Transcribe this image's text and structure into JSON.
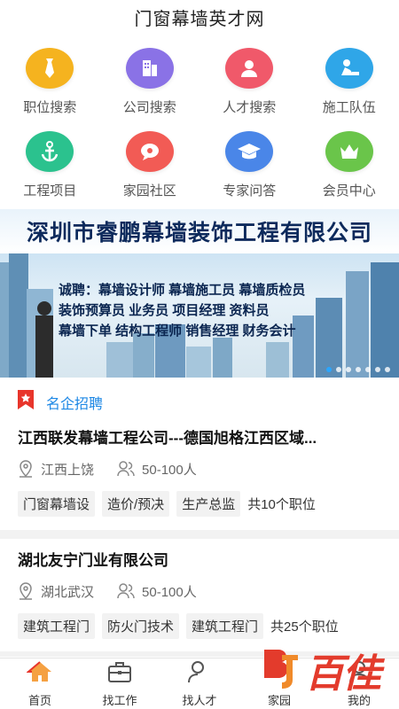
{
  "app": {
    "title": "门窗幕墙英才网"
  },
  "grid": [
    {
      "label": "职位搜索",
      "icon": "tie-icon",
      "color": "#f5b31f"
    },
    {
      "label": "公司搜索",
      "icon": "building-icon",
      "color": "#8a72e6"
    },
    {
      "label": "人才搜索",
      "icon": "person-icon",
      "color": "#f0596a"
    },
    {
      "label": "施工队伍",
      "icon": "worker-icon",
      "color": "#2fa6e8"
    },
    {
      "label": "工程项目",
      "icon": "anchor-icon",
      "color": "#2bc28e"
    },
    {
      "label": "家园社区",
      "icon": "chat-icon",
      "color": "#f25b55"
    },
    {
      "label": "专家问答",
      "icon": "graduation-cap-icon",
      "color": "#4a86e8"
    },
    {
      "label": "会员中心",
      "icon": "crown-icon",
      "color": "#6ac54a"
    }
  ],
  "banner": {
    "company": "深圳市睿鹏幕墙装饰工程有限公司",
    "lines": [
      "诚聘：幕墙设计师  幕墙施工员  幕墙质检员",
      "装饰预算员  业务员  项目经理  资料员",
      "幕墙下单  结构工程师  销售经理  财务会计"
    ],
    "dots": 7,
    "active_dot": 0
  },
  "section": {
    "title": "名企招聘",
    "accent": "#e8352b"
  },
  "jobs": [
    {
      "company": "江西联发幕墙工程公司---德国旭格江西区域...",
      "location": "江西上饶",
      "size": "50-100人",
      "tags": [
        "门窗幕墙设",
        "造价/预决",
        "生产总监"
      ],
      "count": "共10个职位"
    },
    {
      "company": "湖北友宁门业有限公司",
      "location": "湖北武汉",
      "size": "50-100人",
      "tags": [
        "建筑工程门",
        "防火门技术",
        "建筑工程门"
      ],
      "count": "共25个职位"
    }
  ],
  "tabs": [
    {
      "label": "首页",
      "icon": "home-icon",
      "active": true
    },
    {
      "label": "找工作",
      "icon": "briefcase-icon"
    },
    {
      "label": "找人才",
      "icon": "person-search-icon"
    },
    {
      "label": "家园",
      "icon": "community-icon"
    },
    {
      "label": "我的",
      "icon": "user-icon"
    }
  ],
  "watermark": {
    "text": "百佳",
    "mark": "BJ"
  }
}
